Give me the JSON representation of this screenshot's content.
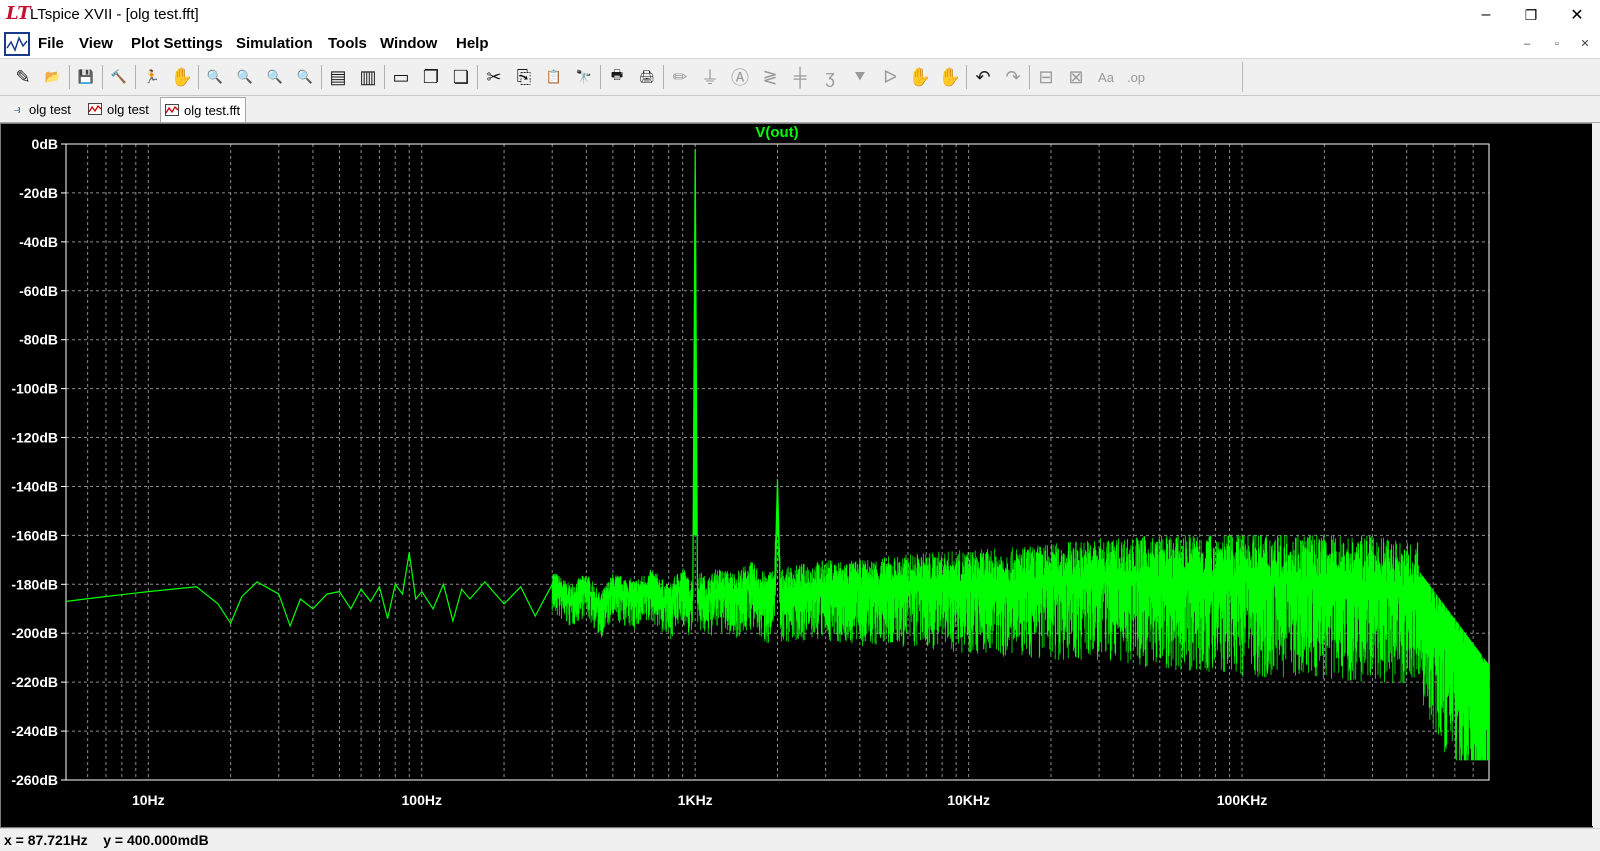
{
  "window": {
    "title": "LTspice XVII - [olg test.fft]",
    "controls": {
      "minimize": "–",
      "restore": "❐",
      "close": "✕"
    }
  },
  "menubar": {
    "items": [
      {
        "label": "File",
        "name": "menu-file"
      },
      {
        "label": "View",
        "name": "menu-view"
      },
      {
        "label": "Plot Settings",
        "name": "menu-plot-settings"
      },
      {
        "label": "Simulation",
        "name": "menu-simulation"
      },
      {
        "label": "Tools",
        "name": "menu-tools"
      },
      {
        "label": "Window",
        "name": "menu-window"
      },
      {
        "label": "Help",
        "name": "menu-help"
      }
    ],
    "mdi_controls": {
      "minimize": "–",
      "restore": "▫",
      "close": "✕"
    }
  },
  "toolbar": {
    "icons": [
      {
        "name": "new-schematic-icon",
        "glyph": "✎",
        "enabled": true
      },
      {
        "name": "open-icon",
        "glyph": "📂",
        "enabled": true
      },
      {
        "name": "save-icon",
        "glyph": "💾",
        "enabled": true
      },
      {
        "name": "control-panel-icon",
        "glyph": "🔨",
        "enabled": true
      },
      {
        "name": "run-icon",
        "glyph": "🏃",
        "enabled": false
      },
      {
        "name": "halt-icon",
        "glyph": "✋",
        "enabled": false
      },
      {
        "name": "zoom-in-icon",
        "glyph": "🔍",
        "enabled": true
      },
      {
        "name": "pan-icon",
        "glyph": "🔍",
        "enabled": true
      },
      {
        "name": "zoom-out-icon",
        "glyph": "🔍",
        "enabled": true
      },
      {
        "name": "zoom-fit-icon",
        "glyph": "🔍",
        "enabled": true
      },
      {
        "name": "autorange-icon",
        "glyph": "▤",
        "enabled": true
      },
      {
        "name": "measure-icon",
        "glyph": "▥",
        "enabled": true
      },
      {
        "name": "tile-horizontal-icon",
        "glyph": "▭",
        "enabled": true
      },
      {
        "name": "cascade-icon",
        "glyph": "❐",
        "enabled": true
      },
      {
        "name": "tile-vertical-icon",
        "glyph": "❏",
        "enabled": true
      },
      {
        "name": "cut-icon",
        "glyph": "✂",
        "enabled": true
      },
      {
        "name": "copy-icon",
        "glyph": "⎘",
        "enabled": true
      },
      {
        "name": "paste-icon",
        "glyph": "📋",
        "enabled": true
      },
      {
        "name": "find-icon",
        "glyph": "🔭",
        "enabled": true
      },
      {
        "name": "print-icon",
        "glyph": "🖶",
        "enabled": true
      },
      {
        "name": "print-preview-icon",
        "glyph": "🖨",
        "enabled": true
      },
      {
        "name": "wire-icon",
        "glyph": "✏",
        "enabled": false
      },
      {
        "name": "ground-icon",
        "glyph": "⏚",
        "enabled": false
      },
      {
        "name": "label-net-icon",
        "glyph": "Ⓐ",
        "enabled": false
      },
      {
        "name": "resistor-icon",
        "glyph": "≷",
        "enabled": false
      },
      {
        "name": "capacitor-icon",
        "glyph": "╪",
        "enabled": false
      },
      {
        "name": "inductor-icon",
        "glyph": "ʒ",
        "enabled": false
      },
      {
        "name": "diode-icon",
        "glyph": "⯆",
        "enabled": false
      },
      {
        "name": "component-icon",
        "glyph": "ᐅ",
        "enabled": false
      },
      {
        "name": "move-icon",
        "glyph": "✋",
        "enabled": false
      },
      {
        "name": "drag-icon",
        "glyph": "✋",
        "enabled": false
      },
      {
        "name": "undo-icon",
        "glyph": "↶",
        "enabled": true
      },
      {
        "name": "redo-icon",
        "glyph": "↷",
        "enabled": false
      },
      {
        "name": "rotate-icon",
        "glyph": "⊟",
        "enabled": false
      },
      {
        "name": "mirror-icon",
        "glyph": "⊠",
        "enabled": false
      },
      {
        "name": "text-icon",
        "glyph": "Aa",
        "enabled": false
      },
      {
        "name": "spice-directive-icon",
        "glyph": ".op",
        "enabled": false
      }
    ]
  },
  "tabs": [
    {
      "label": "olg test",
      "icon": "schematic-icon",
      "active": false
    },
    {
      "label": "olg test",
      "icon": "waveform-icon",
      "active": false
    },
    {
      "label": "olg test.fft",
      "icon": "fft-icon",
      "active": true
    }
  ],
  "plot": {
    "trace_label": "V(out)",
    "trace_color": "#00ff00",
    "background": "#000000",
    "axis_color": "#ffffff",
    "grid_color": "#8c8c8c"
  },
  "chart_data": {
    "type": "line",
    "title": "",
    "xlabel": "",
    "ylabel": "",
    "x_scale": "log",
    "xlim": [
      5,
      800000
    ],
    "ylim": [
      -260,
      0
    ],
    "grid": true,
    "legend": "none",
    "x_ticks": [
      {
        "value": 10,
        "label": "10Hz"
      },
      {
        "value": 100,
        "label": "100Hz"
      },
      {
        "value": 1000,
        "label": "1KHz"
      },
      {
        "value": 10000,
        "label": "10KHz"
      },
      {
        "value": 100000,
        "label": "100KHz"
      }
    ],
    "y_ticks": [
      {
        "value": 0,
        "label": "0dB"
      },
      {
        "value": -20,
        "label": "-20dB"
      },
      {
        "value": -40,
        "label": "-40dB"
      },
      {
        "value": -60,
        "label": "-60dB"
      },
      {
        "value": -80,
        "label": "-80dB"
      },
      {
        "value": -100,
        "label": "-100dB"
      },
      {
        "value": -120,
        "label": "-120dB"
      },
      {
        "value": -140,
        "label": "-140dB"
      },
      {
        "value": -160,
        "label": "-160dB"
      },
      {
        "value": -180,
        "label": "-180dB"
      },
      {
        "value": -200,
        "label": "-200dB"
      },
      {
        "value": -220,
        "label": "-220dB"
      },
      {
        "value": -240,
        "label": "-240dB"
      },
      {
        "value": -260,
        "label": "-260dB"
      }
    ],
    "series": [
      {
        "name": "V(out)",
        "color": "#00ff00",
        "x": [
          5,
          7,
          10,
          15,
          18,
          20,
          22,
          25,
          30,
          33,
          36,
          40,
          45,
          50,
          55,
          60,
          65,
          70,
          75,
          80,
          85,
          90,
          95,
          100,
          110,
          120,
          130,
          140,
          150,
          170,
          200,
          230,
          260,
          300,
          350,
          400,
          450,
          500,
          600,
          700,
          800,
          900,
          950,
          980,
          1000,
          1020,
          1050,
          1100,
          1200,
          1400,
          1600,
          1800,
          1950,
          2000,
          2050,
          2200,
          2500,
          3000,
          4000,
          5000,
          7000,
          10000,
          15000,
          20000,
          30000,
          50000,
          70000,
          100000,
          150000,
          200000,
          300000,
          400000,
          450000,
          480000,
          500000,
          600000,
          700000,
          800000
        ],
        "y": [
          -187,
          -185,
          -183,
          -181,
          -188,
          -196,
          -185,
          -179,
          -184,
          -197,
          -186,
          -190,
          -184,
          -183,
          -190,
          -182,
          -187,
          -181,
          -194,
          -180,
          -184,
          -167,
          -186,
          -183,
          -190,
          -180,
          -195,
          -182,
          -186,
          -179,
          -188,
          -181,
          -193,
          -180,
          -186,
          -181,
          -190,
          -182,
          -185,
          -181,
          -188,
          -180,
          -186,
          -185,
          -2,
          -186,
          -183,
          -186,
          -182,
          -184,
          -180,
          -185,
          -183,
          -137,
          -184,
          -183,
          -182,
          -181,
          -182,
          -181,
          -180,
          -180,
          -180,
          -179,
          -178,
          -178,
          -178,
          -178,
          -178,
          -179,
          -180,
          -182,
          -183,
          -184,
          -193,
          -200,
          -210,
          -220
        ]
      }
    ],
    "cursor_readout": {
      "x": "87.721Hz",
      "y": "400.000mdB"
    }
  },
  "status": {
    "cursor_text": "x = 87.721Hz    y = 400.000mdB"
  }
}
